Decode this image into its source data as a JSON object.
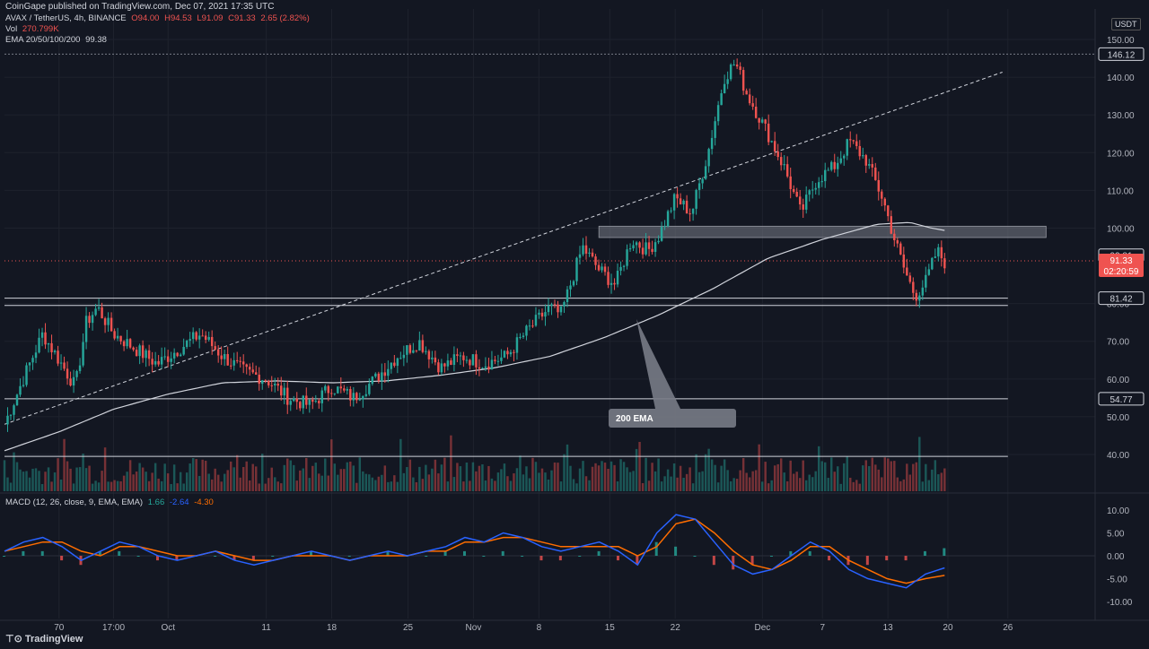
{
  "publisher": "CoinGape published on TradingView.com, Dec 07, 2021 17:35 UTC",
  "header": {
    "symbol": "AVAX / TetherUS, 4h, BINANCE",
    "ohlc_o": "O94.00",
    "ohlc_h": "H94.53",
    "ohlc_l": "L91.09",
    "ohlc_c": "C91.33",
    "change": "2.65 (2.82%)",
    "vol_label": "Vol",
    "vol_value": "270.799K",
    "ema_label": "EMA 20/50/100/200",
    "ema_value": "99.38",
    "macd_label": "MACD (12, 26, close, 9, EMA, EMA)",
    "macd_hist": "1.66",
    "macd_line": "-2.64",
    "macd_signal": "-4.30"
  },
  "currency_label": "USDT",
  "footer_brand": "TradingView",
  "annotation_text": "200 EMA",
  "price_axis_labels": [
    "150.00",
    "140.00",
    "130.00",
    "120.00",
    "110.00",
    "100.00",
    "80.00",
    "70.00",
    "60.00",
    "50.00",
    "40.00"
  ],
  "price_axis_values": [
    150,
    140,
    130,
    120,
    110,
    100,
    80,
    70,
    60,
    50,
    40
  ],
  "price_tags": [
    {
      "text": "146.12",
      "value": 146.12,
      "kind": "line"
    },
    {
      "text": "92.81",
      "value": 92.81,
      "kind": "line"
    },
    {
      "text": "81.42",
      "value": 81.42,
      "kind": "line"
    },
    {
      "text": "54.77",
      "value": 54.77,
      "kind": "line"
    }
  ],
  "current_price": {
    "text": "91.33",
    "countdown": "02:20:59",
    "value": 91.33
  },
  "macd_axis_labels": [
    "10.00",
    "5.00",
    "0.00",
    "-5.00",
    "-10.00"
  ],
  "macd_axis_values": [
    10,
    5,
    0,
    -5,
    -10
  ],
  "time_axis": [
    {
      "label": "70",
      "t": 0.05
    },
    {
      "label": "17:00",
      "t": 0.1
    },
    {
      "label": "Oct",
      "t": 0.15
    },
    {
      "label": "11",
      "t": 0.24
    },
    {
      "label": "18",
      "t": 0.3
    },
    {
      "label": "25",
      "t": 0.37
    },
    {
      "label": "Nov",
      "t": 0.43
    },
    {
      "label": "8",
      "t": 0.49
    },
    {
      "label": "15",
      "t": 0.555
    },
    {
      "label": "22",
      "t": 0.615
    },
    {
      "label": "Dec",
      "t": 0.695
    },
    {
      "label": "7",
      "t": 0.75
    },
    {
      "label": "13",
      "t": 0.81
    },
    {
      "label": "20",
      "t": 0.865
    },
    {
      "label": "26",
      "t": 0.92
    }
  ],
  "colors": {
    "background": "#131722",
    "up": "#26a69a",
    "down": "#ef5350",
    "ema": "#d1d4dc",
    "macd_line": "#2962ff",
    "signal_line": "#ff6d00",
    "zone": "#787b86"
  },
  "chart_data": {
    "type": "candlestick",
    "symbol": "AVAX / TetherUS",
    "interval": "4h",
    "ylim": [
      30,
      153
    ],
    "close_path": [
      {
        "t": 0.0,
        "v": 48
      },
      {
        "t": 0.02,
        "v": 62
      },
      {
        "t": 0.035,
        "v": 72
      },
      {
        "t": 0.05,
        "v": 65
      },
      {
        "t": 0.065,
        "v": 58
      },
      {
        "t": 0.075,
        "v": 75
      },
      {
        "t": 0.085,
        "v": 79
      },
      {
        "t": 0.1,
        "v": 72
      },
      {
        "t": 0.12,
        "v": 68
      },
      {
        "t": 0.14,
        "v": 64
      },
      {
        "t": 0.16,
        "v": 68
      },
      {
        "t": 0.18,
        "v": 72
      },
      {
        "t": 0.2,
        "v": 66
      },
      {
        "t": 0.22,
        "v": 62
      },
      {
        "t": 0.24,
        "v": 60
      },
      {
        "t": 0.26,
        "v": 55
      },
      {
        "t": 0.28,
        "v": 53
      },
      {
        "t": 0.3,
        "v": 58
      },
      {
        "t": 0.32,
        "v": 55
      },
      {
        "t": 0.34,
        "v": 60
      },
      {
        "t": 0.36,
        "v": 66
      },
      {
        "t": 0.38,
        "v": 70
      },
      {
        "t": 0.4,
        "v": 63
      },
      {
        "t": 0.42,
        "v": 66
      },
      {
        "t": 0.44,
        "v": 64
      },
      {
        "t": 0.46,
        "v": 66
      },
      {
        "t": 0.48,
        "v": 73
      },
      {
        "t": 0.5,
        "v": 79
      },
      {
        "t": 0.51,
        "v": 77
      },
      {
        "t": 0.52,
        "v": 86
      },
      {
        "t": 0.53,
        "v": 95
      },
      {
        "t": 0.545,
        "v": 89
      },
      {
        "t": 0.56,
        "v": 85
      },
      {
        "t": 0.575,
        "v": 97
      },
      {
        "t": 0.59,
        "v": 94
      },
      {
        "t": 0.6,
        "v": 98
      },
      {
        "t": 0.615,
        "v": 108
      },
      {
        "t": 0.63,
        "v": 104
      },
      {
        "t": 0.645,
        "v": 120
      },
      {
        "t": 0.66,
        "v": 140
      },
      {
        "t": 0.67,
        "v": 144
      },
      {
        "t": 0.68,
        "v": 136
      },
      {
        "t": 0.7,
        "v": 125
      },
      {
        "t": 0.715,
        "v": 116
      },
      {
        "t": 0.73,
        "v": 104
      },
      {
        "t": 0.745,
        "v": 113
      },
      {
        "t": 0.76,
        "v": 116
      },
      {
        "t": 0.775,
        "v": 123
      },
      {
        "t": 0.79,
        "v": 118
      },
      {
        "t": 0.805,
        "v": 108
      },
      {
        "t": 0.815,
        "v": 98
      },
      {
        "t": 0.825,
        "v": 89
      },
      {
        "t": 0.835,
        "v": 82
      },
      {
        "t": 0.845,
        "v": 86
      },
      {
        "t": 0.855,
        "v": 94
      },
      {
        "t": 0.862,
        "v": 91
      }
    ],
    "ema200_path": [
      {
        "t": 0.0,
        "v": 41
      },
      {
        "t": 0.05,
        "v": 46
      },
      {
        "t": 0.1,
        "v": 52
      },
      {
        "t": 0.15,
        "v": 56
      },
      {
        "t": 0.2,
        "v": 59
      },
      {
        "t": 0.25,
        "v": 59.5
      },
      {
        "t": 0.3,
        "v": 59
      },
      {
        "t": 0.35,
        "v": 59.5
      },
      {
        "t": 0.4,
        "v": 61
      },
      {
        "t": 0.45,
        "v": 63
      },
      {
        "t": 0.5,
        "v": 66
      },
      {
        "t": 0.55,
        "v": 71
      },
      {
        "t": 0.6,
        "v": 77
      },
      {
        "t": 0.65,
        "v": 84
      },
      {
        "t": 0.7,
        "v": 92
      },
      {
        "t": 0.75,
        "v": 97
      },
      {
        "t": 0.8,
        "v": 101
      },
      {
        "t": 0.83,
        "v": 101.5
      },
      {
        "t": 0.85,
        "v": 100
      },
      {
        "t": 0.862,
        "v": 99.4
      }
    ],
    "horizontal_levels": [
      146.12,
      81.42,
      79.5,
      54.77,
      39.5
    ],
    "resistance_zone": {
      "from": 97.5,
      "to": 100.5,
      "t_start": 0.545,
      "t_end": 0.955
    },
    "trendline": {
      "t1": 0.0,
      "v1": 48,
      "t2": 1.0,
      "v2": 150
    },
    "macd": {
      "macd_line": [
        1,
        3,
        4,
        2,
        -1,
        1,
        3,
        2,
        0,
        -1,
        0,
        1,
        -1,
        -2,
        -1,
        0,
        1,
        0,
        -1,
        0,
        1,
        0,
        1,
        2,
        4,
        3,
        5,
        4,
        2,
        1,
        2,
        3,
        1,
        -2,
        5,
        9,
        8,
        3,
        -2,
        -4,
        -3,
        0,
        3,
        1,
        -3,
        -5,
        -6,
        -7,
        -4,
        -2.64
      ],
      "signal_line": [
        1,
        2,
        3,
        3,
        1,
        0,
        2,
        2,
        1,
        0,
        0,
        1,
        0,
        -1,
        -1,
        0,
        0,
        0,
        -1,
        0,
        0,
        0,
        1,
        1,
        3,
        3,
        4,
        4,
        3,
        2,
        2,
        2,
        2,
        0,
        2,
        7,
        8,
        5,
        1,
        -2,
        -3,
        -1,
        2,
        2,
        -1,
        -3,
        -5,
        -6,
        -5,
        -4.3
      ],
      "histogram": [
        0,
        1,
        1,
        -1,
        -2,
        1,
        1,
        0,
        -1,
        -1,
        0,
        0,
        -1,
        -1,
        0,
        0,
        1,
        0,
        0,
        0,
        1,
        0,
        0,
        1,
        1,
        0,
        1,
        0,
        -1,
        -1,
        0,
        1,
        -1,
        -2,
        3,
        2,
        0,
        -2,
        -3,
        -2,
        0,
        1,
        1,
        -1,
        -2,
        -2,
        -1,
        -1,
        1,
        1.66
      ]
    }
  }
}
